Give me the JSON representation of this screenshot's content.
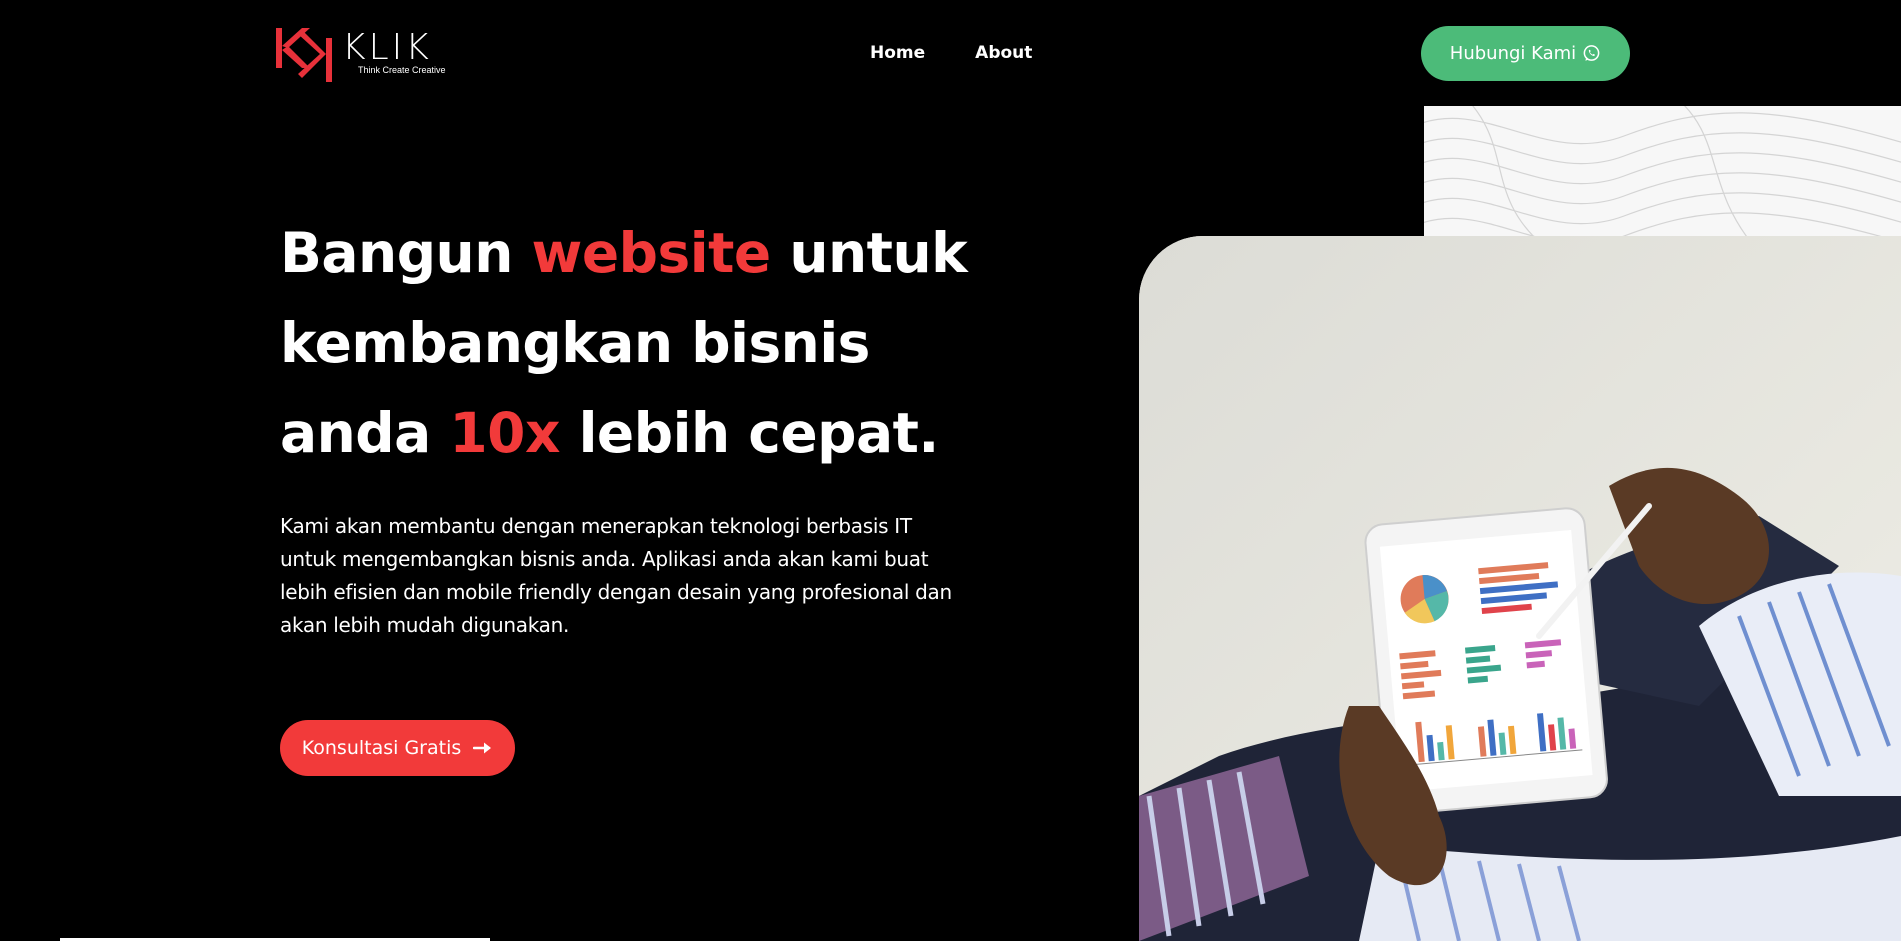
{
  "header": {
    "logo": {
      "word": "KLIK",
      "tagline": "Think Create Creative"
    },
    "nav": [
      {
        "label": "Home"
      },
      {
        "label": "About"
      }
    ],
    "contact_button": {
      "label": "Hubungi Kami",
      "icon": "whatsapp-icon"
    }
  },
  "hero": {
    "title": {
      "part1": "Bangun ",
      "accent1": "website",
      "part2": " untuk kembangkan bisnis anda ",
      "accent2": "10x",
      "part3": " lebih cepat."
    },
    "description": "Kami akan membantu dengan menerapkan teknologi berbasis IT untuk mengembangkan bisnis anda. Aplikasi anda akan kami buat lebih efisien dan mobile friendly dengan desain yang profesional dan akan lebih mudah digunakan.",
    "cta": {
      "label": "Konsultasi Gratis",
      "icon": "arrow-right-icon"
    }
  },
  "colors": {
    "background": "#000000",
    "accent_red": "#f23a3a",
    "accent_green": "#4cbb79",
    "text": "#ffffff"
  }
}
